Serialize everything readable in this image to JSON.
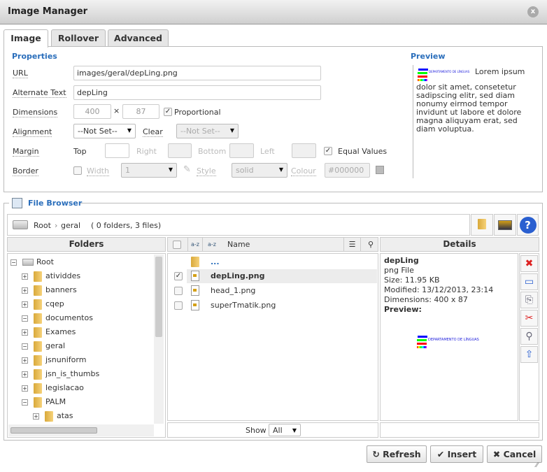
{
  "window": {
    "title": "Image Manager",
    "close_icon": "close-icon"
  },
  "tabs": [
    {
      "label": "Image",
      "active": true
    },
    {
      "label": "Rollover"
    },
    {
      "label": "Advanced"
    }
  ],
  "properties": {
    "heading": "Properties",
    "url_label": "URL",
    "url_value": "images/geral/depLing.png",
    "alt_label": "Alternate Text",
    "alt_value": "depLing",
    "dimensions_label": "Dimensions",
    "width": "400",
    "x": "×",
    "height": "87",
    "proportional_label": "Proportional",
    "proportional": true,
    "alignment_label": "Alignment",
    "alignment_value": "--Not Set--",
    "clear_label": "Clear",
    "clear_value": "--Not Set--",
    "margin_label": "Margin",
    "top_label": "Top",
    "right_label": "Right",
    "bottom_label": "Bottom",
    "left_label": "Left",
    "equal_values_label": "Equal Values",
    "equal_values": true,
    "border_label": "Border",
    "border_checked": false,
    "width_label": "Width",
    "width_value": "1",
    "style_label": "Style",
    "style_value": "solid",
    "colour_label": "Colour",
    "colour_value": "#000000"
  },
  "preview": {
    "heading": "Preview",
    "logo_text": "DEPARTAMENTO DE LÍNGUAS",
    "text": "Lorem ipsum dolor sit amet, consetetur sadipscing elitr, sed diam nonumy eirmod tempor invidunt ut labore et dolore magna aliquyam erat, sed diam voluptua."
  },
  "file_browser": {
    "legend": "File Browser",
    "path_root": "Root",
    "path_sep": "›",
    "path_current": "geral",
    "summary": "( 0 folders, 3 files)",
    "folders_header": "Folders",
    "name_header": "Name",
    "details_header": "Details",
    "tree": [
      {
        "label": "Root",
        "toggle": "−",
        "level": 0,
        "icon": "drive-icon"
      },
      {
        "label": "atividdes",
        "toggle": "+",
        "level": 1
      },
      {
        "label": "banners",
        "toggle": "+",
        "level": 1
      },
      {
        "label": "cqep",
        "toggle": "+",
        "level": 1
      },
      {
        "label": "documentos",
        "toggle": "−",
        "level": 1
      },
      {
        "label": "Exames",
        "toggle": "+",
        "level": 1
      },
      {
        "label": "geral",
        "toggle": "−",
        "level": 1
      },
      {
        "label": "jsnuniform",
        "toggle": "+",
        "level": 1
      },
      {
        "label": "jsn_is_thumbs",
        "toggle": "+",
        "level": 1
      },
      {
        "label": "legislacao",
        "toggle": "+",
        "level": 1
      },
      {
        "label": "PALM",
        "toggle": "−",
        "level": 1
      },
      {
        "label": "atas",
        "toggle": "+",
        "level": 2
      }
    ],
    "up_label": "...",
    "files": [
      {
        "name": "depLing.png",
        "selected": true
      },
      {
        "name": "head_1.png",
        "selected": false
      },
      {
        "name": "superTmatik.png",
        "selected": false
      }
    ],
    "details": {
      "name": "depLing",
      "type": "png File",
      "size": "Size: 11.95 KB",
      "modified": "Modified: 13/12/2013, 23:14",
      "dimensions": "Dimensions: 400 x 87",
      "preview_label": "Preview:"
    },
    "show_label": "Show",
    "show_value": "All"
  },
  "buttons": {
    "refresh": "Refresh",
    "insert": "Insert",
    "cancel": "Cancel"
  },
  "colors": {
    "accent": "#2a6ebb",
    "delete": "#d22"
  }
}
